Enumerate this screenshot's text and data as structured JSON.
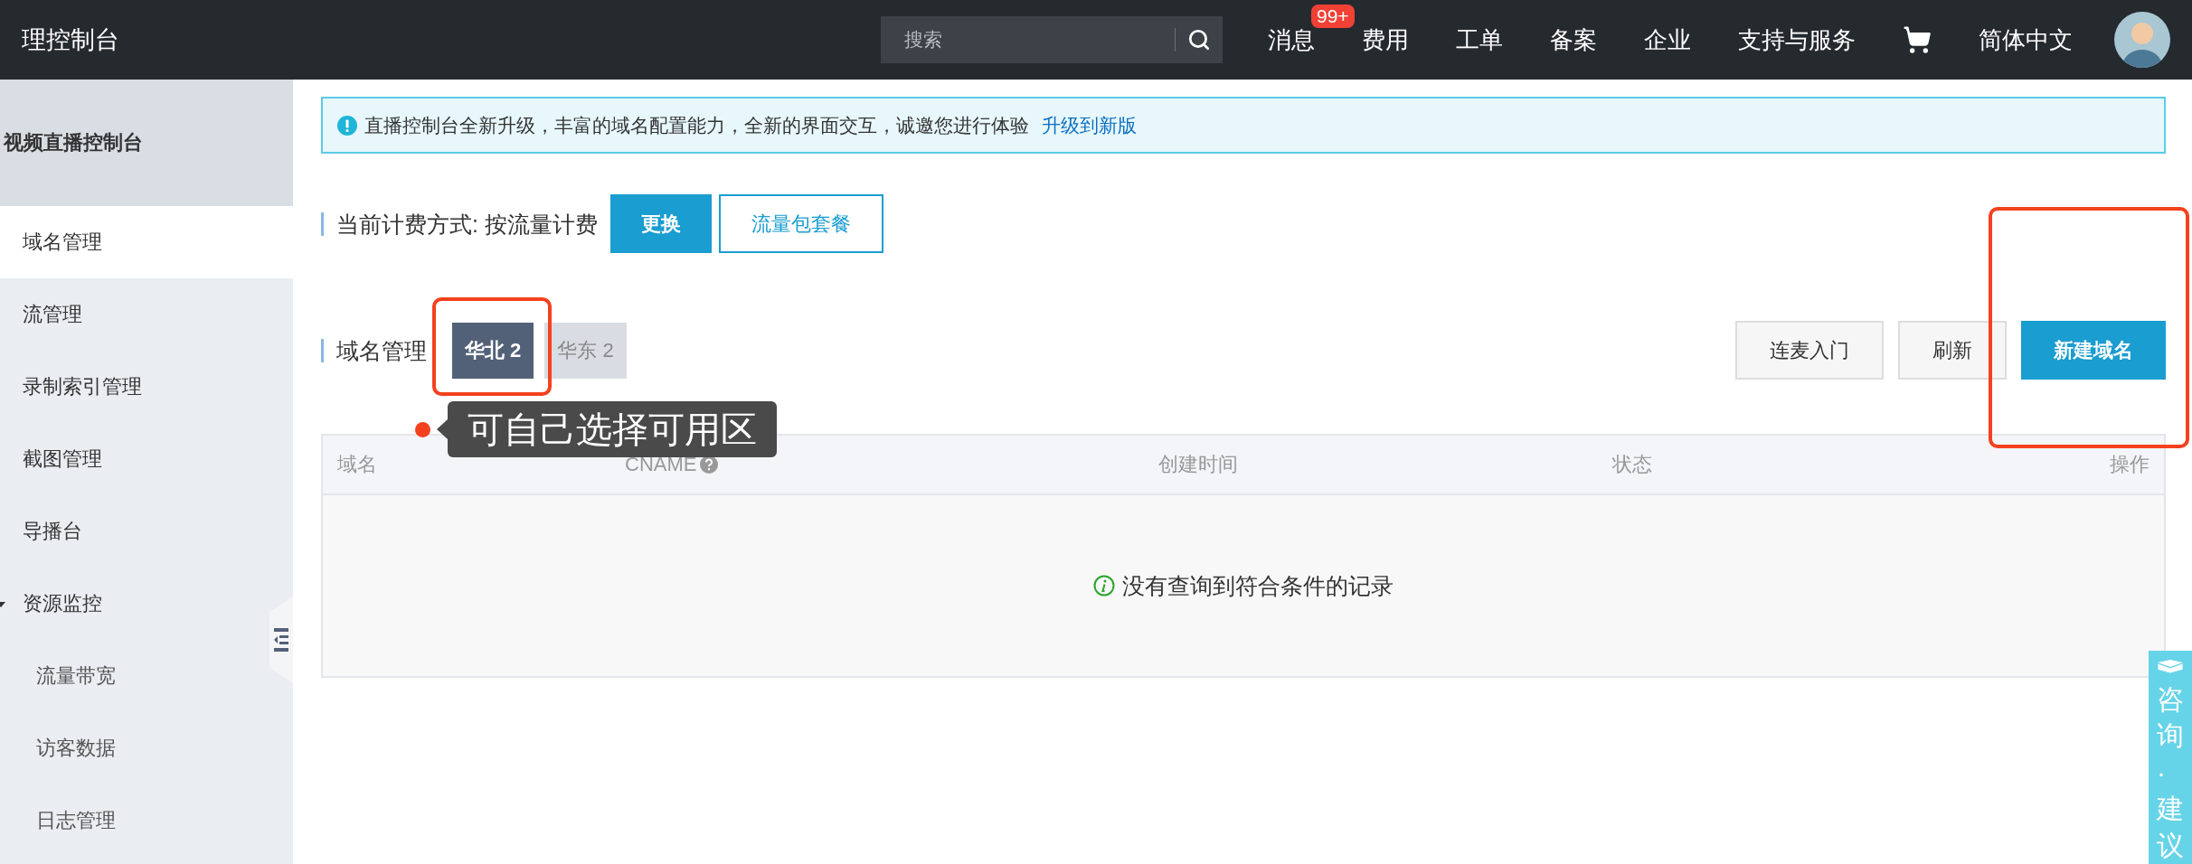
{
  "header": {
    "title": "理控制台",
    "search": {
      "placeholder": "搜索"
    },
    "nav": [
      {
        "label": "消息",
        "badge": "99+"
      },
      {
        "label": "费用"
      },
      {
        "label": "工单"
      },
      {
        "label": "备案"
      },
      {
        "label": "企业"
      },
      {
        "label": "支持与服务"
      }
    ],
    "language": "简体中文"
  },
  "sidebar": {
    "title": "视频直播控制台",
    "items": [
      {
        "label": "域名管理",
        "selected": true
      },
      {
        "label": "流管理",
        "selected": false
      },
      {
        "label": "录制索引管理",
        "selected": false
      },
      {
        "label": "截图管理",
        "selected": false
      },
      {
        "label": "导播台",
        "selected": false
      },
      {
        "label": "资源监控",
        "selected": false,
        "expanded": true,
        "children": [
          {
            "label": "流量带宽",
            "selected": false
          },
          {
            "label": "访客数据",
            "selected": false
          },
          {
            "label": "日志管理",
            "selected": false
          }
        ]
      }
    ]
  },
  "notice": {
    "text": "直播控制台全新升级，丰富的域名配置能力，全新的界面交互，诚邀您进行体验",
    "link": "升级到新版"
  },
  "billing": {
    "label": "当前计费方式: 按流量计费",
    "buttons": [
      {
        "label": "更换",
        "kind": "primary"
      },
      {
        "label": "流量包套餐",
        "kind": "outline"
      }
    ]
  },
  "domains": {
    "title": "域名管理",
    "regions": [
      {
        "label": "华北 2",
        "selected": true
      },
      {
        "label": "华东 2",
        "selected": false
      }
    ],
    "actions": [
      {
        "label": "连麦入门",
        "kind": "default"
      },
      {
        "label": "刷新",
        "kind": "default"
      },
      {
        "label": "新建域名",
        "kind": "primary"
      }
    ],
    "table": {
      "columns": [
        {
          "label": "域名",
          "kind": "plain"
        },
        {
          "label": "CNAME",
          "kind": "help"
        },
        {
          "label": "创建时间",
          "kind": "plain"
        },
        {
          "label": "状态",
          "kind": "plain"
        },
        {
          "label": "操作",
          "kind": "action"
        }
      ],
      "empty_message": "没有查询到符合条件的记录"
    }
  },
  "callout": {
    "text": "可自己选择可用区"
  },
  "feedback_tab": {
    "label": "咨询·建议"
  }
}
